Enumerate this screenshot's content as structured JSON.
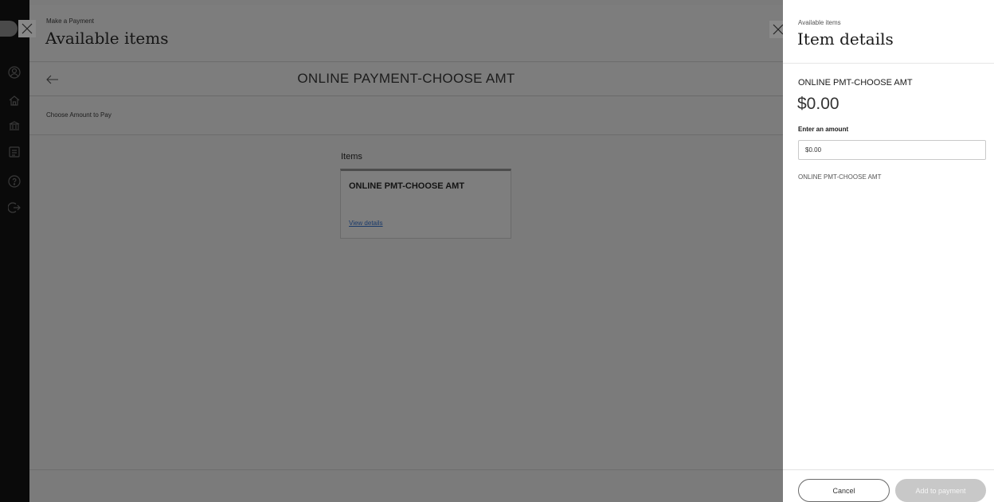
{
  "background_modal": {
    "eyebrow": "Make a Payment",
    "title": "Available items",
    "subheader_title": "ONLINE PAYMENT-CHOOSE AMT",
    "amount_label": "Choose Amount to Pay",
    "items_title": "Items",
    "item_card": {
      "name": "ONLINE PMT-CHOOSE AMT",
      "link": "View details"
    }
  },
  "nav": {
    "icons": [
      "user-circle-icon",
      "home-icon",
      "bank-icon",
      "bill-icon",
      "help-icon",
      "logout-icon"
    ]
  },
  "detail_panel": {
    "eyebrow": "Available items",
    "title": "Item details",
    "item_name": "ONLINE PMT-CHOOSE AMT",
    "price": "$0.00",
    "amount_label": "Enter an amount",
    "amount_value": "$0.00",
    "description": "ONLINE PMT-CHOOSE AMT",
    "cancel_label": "Cancel",
    "add_label": "Add to payment"
  },
  "colors": {
    "overlay": "#7b7b7b",
    "rail": "#0a0a0a",
    "panel": "#ffffff",
    "disabled_button": "#c8c8c8"
  }
}
